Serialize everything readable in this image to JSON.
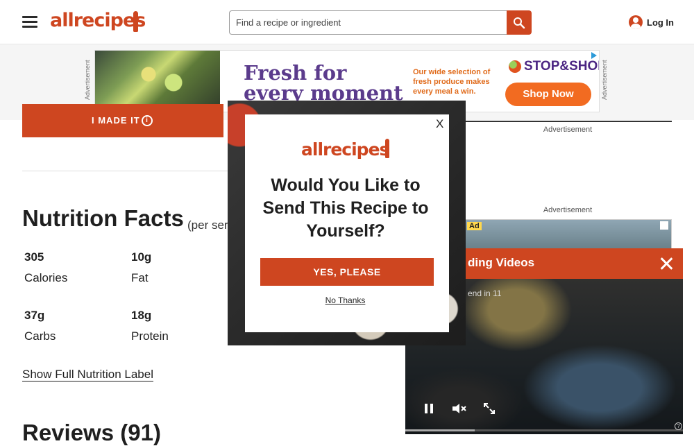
{
  "header": {
    "logo": "allrecipes",
    "search_placeholder": "Find a recipe or ingredient",
    "login_label": "Log In"
  },
  "top_ad": {
    "label_left": "Advertisement",
    "label_right": "Advertisement",
    "headline": "Fresh for every moment",
    "subtext": "Our wide selection of fresh produce makes every meal a win.",
    "brand": "STOP&SHOP.",
    "cta": "Shop Now"
  },
  "recipe": {
    "made_it_label": "I MADE IT",
    "nutrition_title": "Nutrition Facts",
    "per_serving": "(per ser",
    "nutrients": [
      {
        "value": "305",
        "label": "Calories"
      },
      {
        "value": "10g",
        "label": "Fat"
      },
      {
        "value": "37g",
        "label": "Carbs"
      },
      {
        "value": "18g",
        "label": "Protein"
      }
    ],
    "show_label": "Show Full Nutrition Label",
    "reviews_title": "Reviews (91)"
  },
  "right_column": {
    "ad_label_1": "Advertisement",
    "ad_label_2": "Advertisement",
    "ad_badge": "Ad"
  },
  "video_player": {
    "title": "ding Videos",
    "skip_text": "end in 11",
    "help": "?"
  },
  "modal": {
    "close": "X",
    "logo": "allrecipes",
    "heading": "Would You Like to Send This Recipe to Yourself?",
    "yes_label": "YES, PLEASE",
    "no_label": "No Thanks"
  },
  "colors": {
    "brand": "#ce4620",
    "ad_purple": "#5b3b8c",
    "ad_orange": "#f26b21"
  }
}
